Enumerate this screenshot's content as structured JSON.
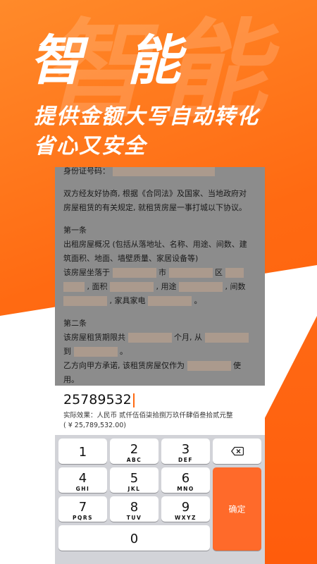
{
  "promo": {
    "watermark": "智能",
    "headline": "智 能",
    "line1": "提供金额大写自动转化",
    "line2": "省心又安全"
  },
  "document": {
    "id_label": "身份证号码：",
    "intro1": "双方经友好协商, 根据《合同法》及国家、当地政府对",
    "intro2": "房屋租赁的有关规定, 就租赁房屋一事打城以下协议。",
    "art1_title": "第一条",
    "art1_l1": "出租房屋概况 (包括从落地址、名称、用途、间数、建",
    "art1_l2": "筑面积、地面、墙壁质量、家居设备等)",
    "art1_l3a": "该房屋坐落于",
    "art1_l3b": "市",
    "art1_l3c": "区",
    "art1_l4a": ", 面积",
    "art1_l4b": ", 用途",
    "art1_l4c": ", 间数",
    "art1_l5a": ", 家具家电",
    "art1_l5b": "。",
    "art2_title": "第二条",
    "art2_l1a": "该房屋租赁期限共",
    "art2_l1b": "个月, 从",
    "art2_l2a": "到",
    "art2_l2b": "。",
    "art2_l3a": "乙方向甲方承诺, 该租赁房屋仅作为",
    "art2_l3b": "使",
    "art2_l4": "用。"
  },
  "input": {
    "value": "25789532",
    "effect_label": "实际效果：人民币 贰仟伍佰柒拾捌万玖仟肆佰叁拾贰元整",
    "effect_number": "( ¥ 25,789,532.00)"
  },
  "keyboard": {
    "k1": {
      "num": "1",
      "let": ""
    },
    "k2": {
      "num": "2",
      "let": "ABC"
    },
    "k3": {
      "num": "3",
      "let": "DEF"
    },
    "k4": {
      "num": "4",
      "let": "GHI"
    },
    "k5": {
      "num": "5",
      "let": "JKL"
    },
    "k6": {
      "num": "6",
      "let": "MNO"
    },
    "k7": {
      "num": "7",
      "let": "PQRS"
    },
    "k8": {
      "num": "8",
      "let": "TUV"
    },
    "k9": {
      "num": "9",
      "let": "WXYZ"
    },
    "k0": {
      "num": "0"
    },
    "confirm": "确定",
    "delete_icon": "backspace-icon"
  },
  "colors": {
    "brand_orange": "#ff6a12",
    "confirm_key": "#ff6a2a",
    "placeholder_fill": "#ab9a8d"
  }
}
